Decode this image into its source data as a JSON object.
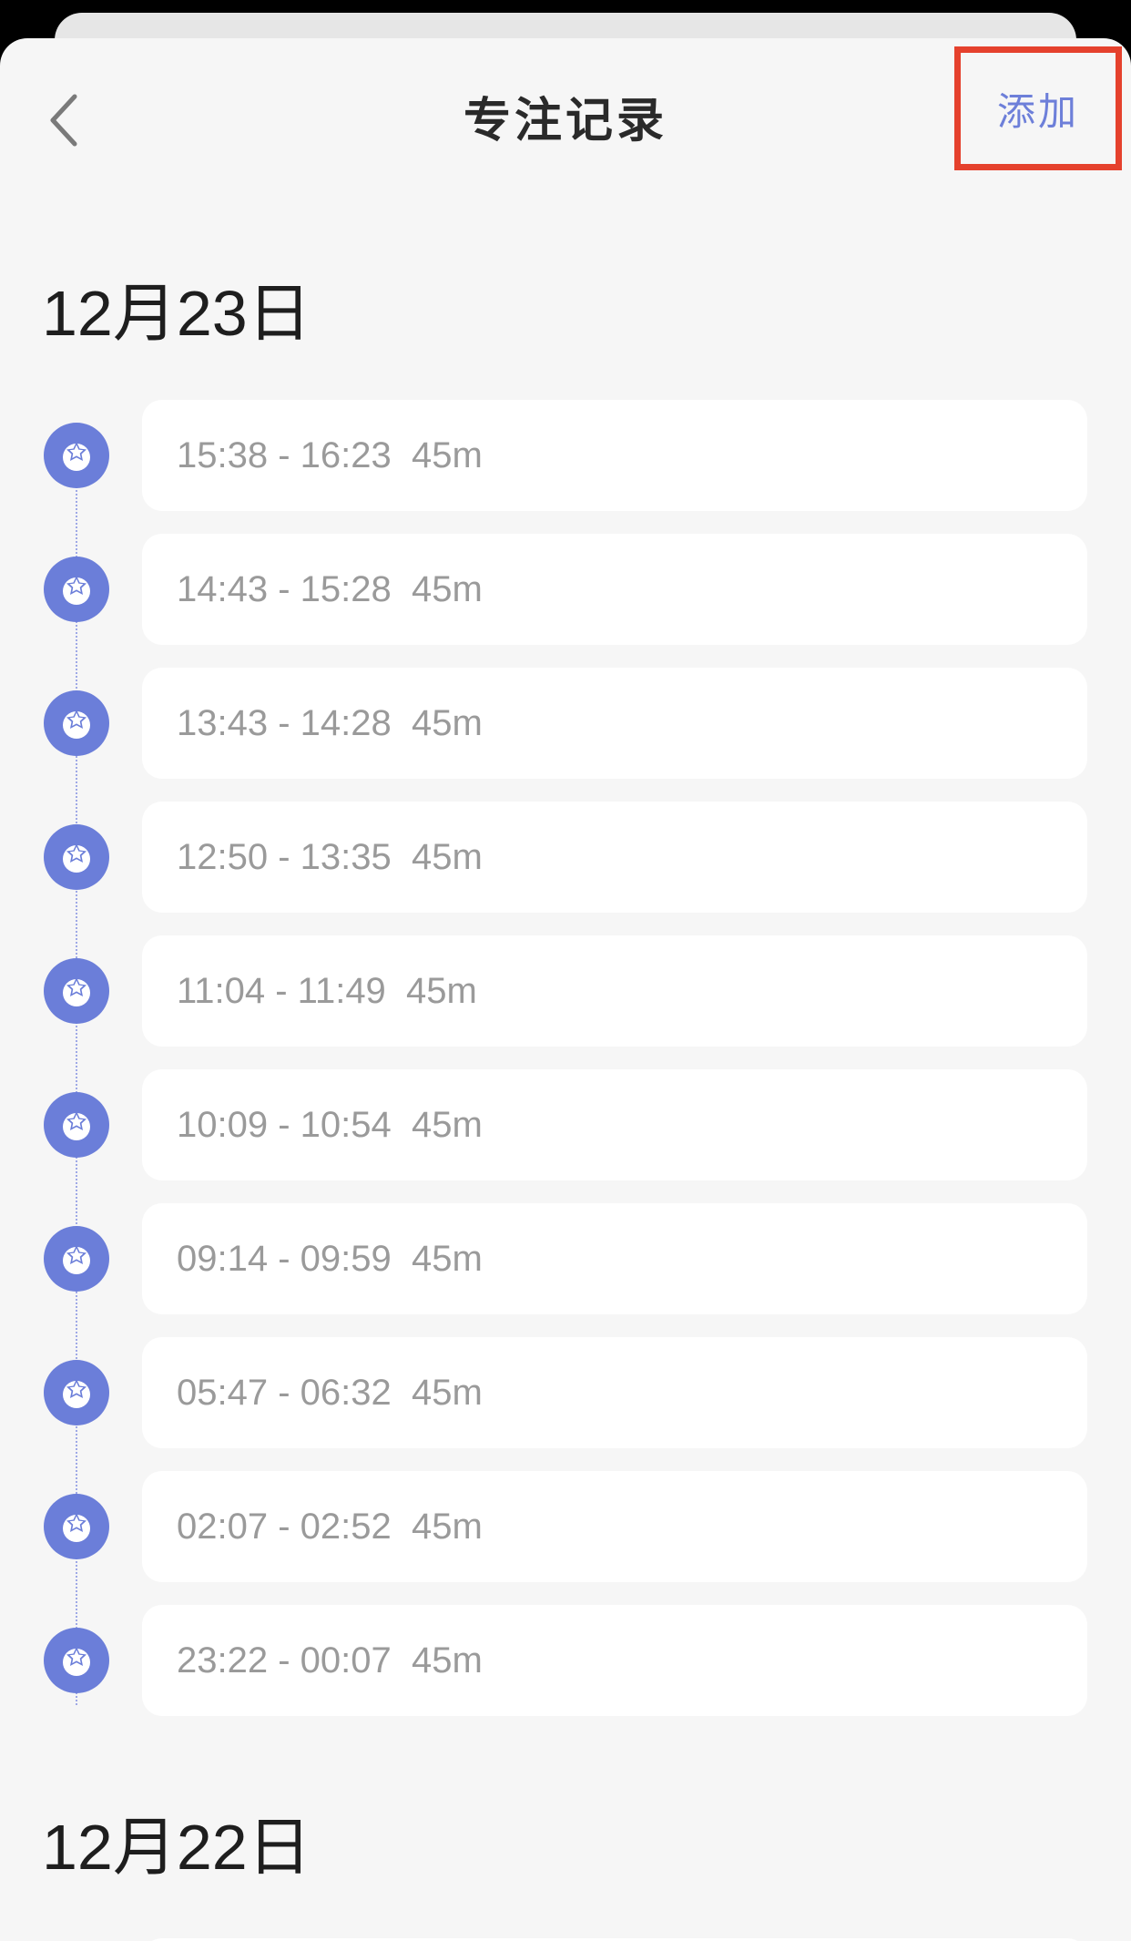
{
  "header": {
    "title": "专注记录",
    "add_label": "添加"
  },
  "colors": {
    "accent": "#6b7ed9",
    "highlight_box": "#e5412d",
    "entry_text": "#9a9a9a"
  },
  "sections": [
    {
      "date": "12月23日",
      "entries": [
        {
          "range": "15:38 - 16:23",
          "duration": "45m"
        },
        {
          "range": "14:43 - 15:28",
          "duration": "45m"
        },
        {
          "range": "13:43 - 14:28",
          "duration": "45m"
        },
        {
          "range": "12:50 - 13:35",
          "duration": "45m"
        },
        {
          "range": "11:04 - 11:49",
          "duration": "45m"
        },
        {
          "range": "10:09 - 10:54",
          "duration": "45m"
        },
        {
          "range": "09:14 - 09:59",
          "duration": "45m"
        },
        {
          "range": "05:47 - 06:32",
          "duration": "45m"
        },
        {
          "range": "02:07 - 02:52",
          "duration": "45m"
        },
        {
          "range": "23:22 - 00:07",
          "duration": "45m"
        }
      ]
    },
    {
      "date": "12月22日",
      "entries": []
    }
  ],
  "icons": {
    "back": "chevron-left-icon",
    "entry": "focus-star-icon"
  }
}
